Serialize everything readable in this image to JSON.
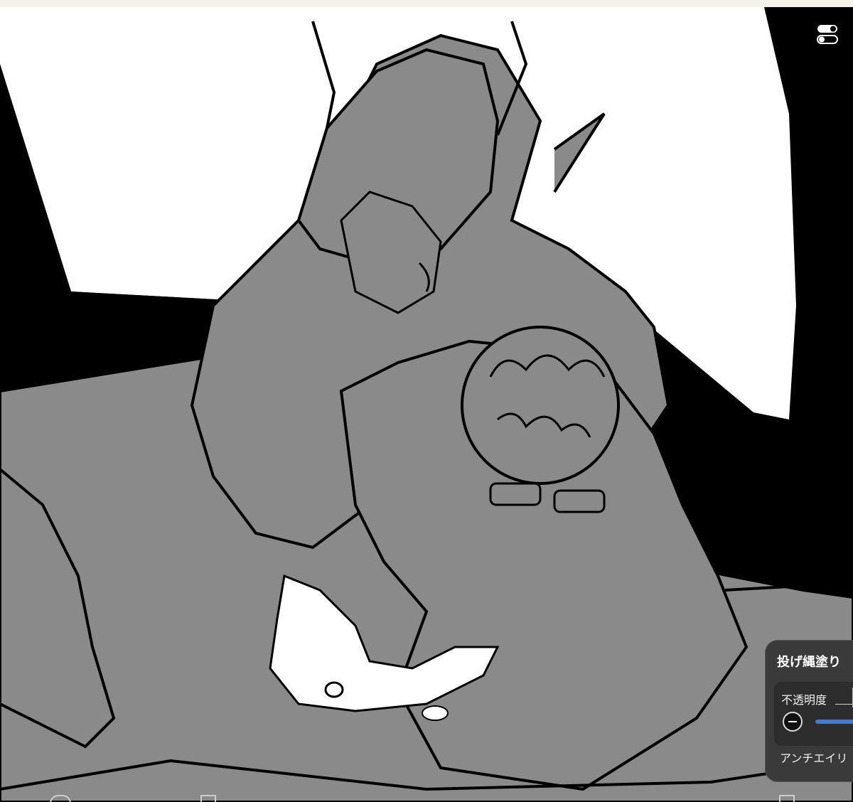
{
  "panel": {
    "title": "投げ縄塗り",
    "opacity_label": "不透明度",
    "antialias_label": "アンチエイリ"
  },
  "icons": {
    "toggle": "toggle-switches-icon",
    "minus": "minus-circle-icon"
  },
  "colors": {
    "canvas_fill": "#8a8a8a",
    "ink": "#000000",
    "paper": "#ffffff",
    "panel_bg": "#3a3a3a",
    "slider": "#4a78c8"
  }
}
